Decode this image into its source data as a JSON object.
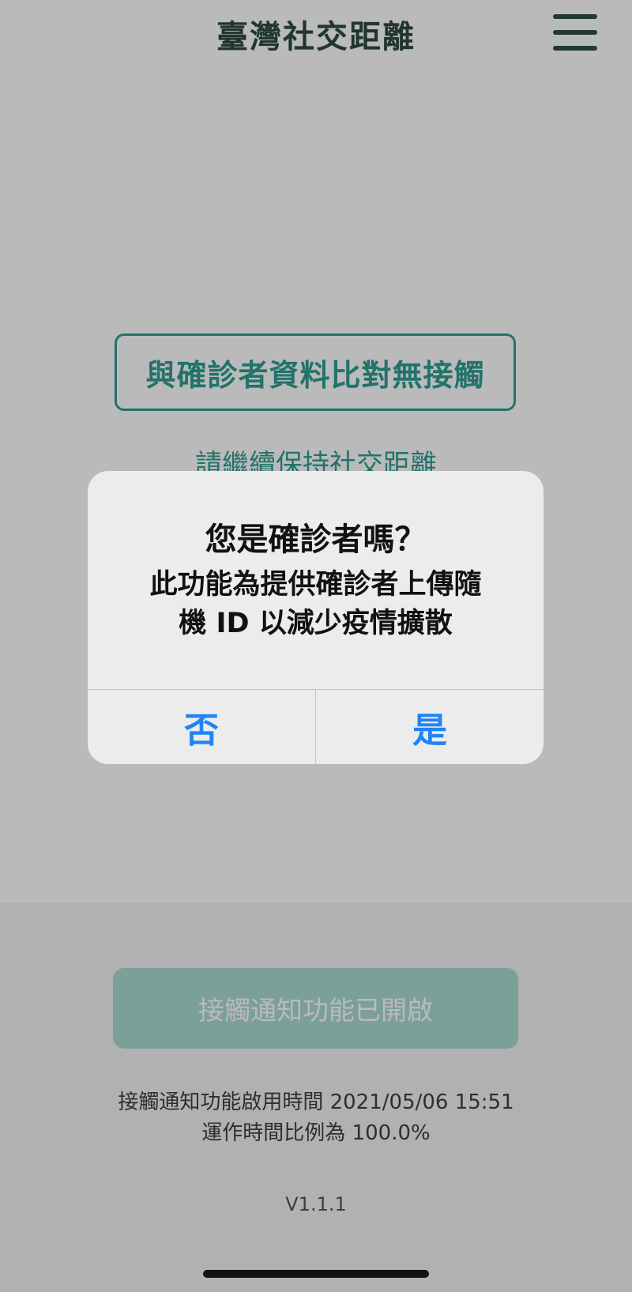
{
  "header": {
    "title": "臺灣社交距離",
    "menu_icon": "hamburger-menu-icon"
  },
  "main": {
    "match_status": "與確診者資料比對無接觸",
    "keep_distance_hint": "請繼續保持社交距離"
  },
  "footer": {
    "notify_status_button": "接觸通知功能已開啟",
    "enable_time_text": "接觸通知功能啟用時間 2021/05/06 15:51",
    "run_ratio_text": "運作時間比例為 100.0%",
    "version": "V1.1.1"
  },
  "dialog": {
    "title": "您是確診者嗎？",
    "message": "此功能為提供確診者上傳隨\n機 ID 以減少疫情擴散",
    "no_label": "否",
    "yes_label": "是"
  },
  "colors": {
    "accent_teal": "#2f9e93",
    "title_dark": "#2e4a44",
    "ios_blue": "#1f84f5",
    "button_fill": "#a9dcd2"
  }
}
